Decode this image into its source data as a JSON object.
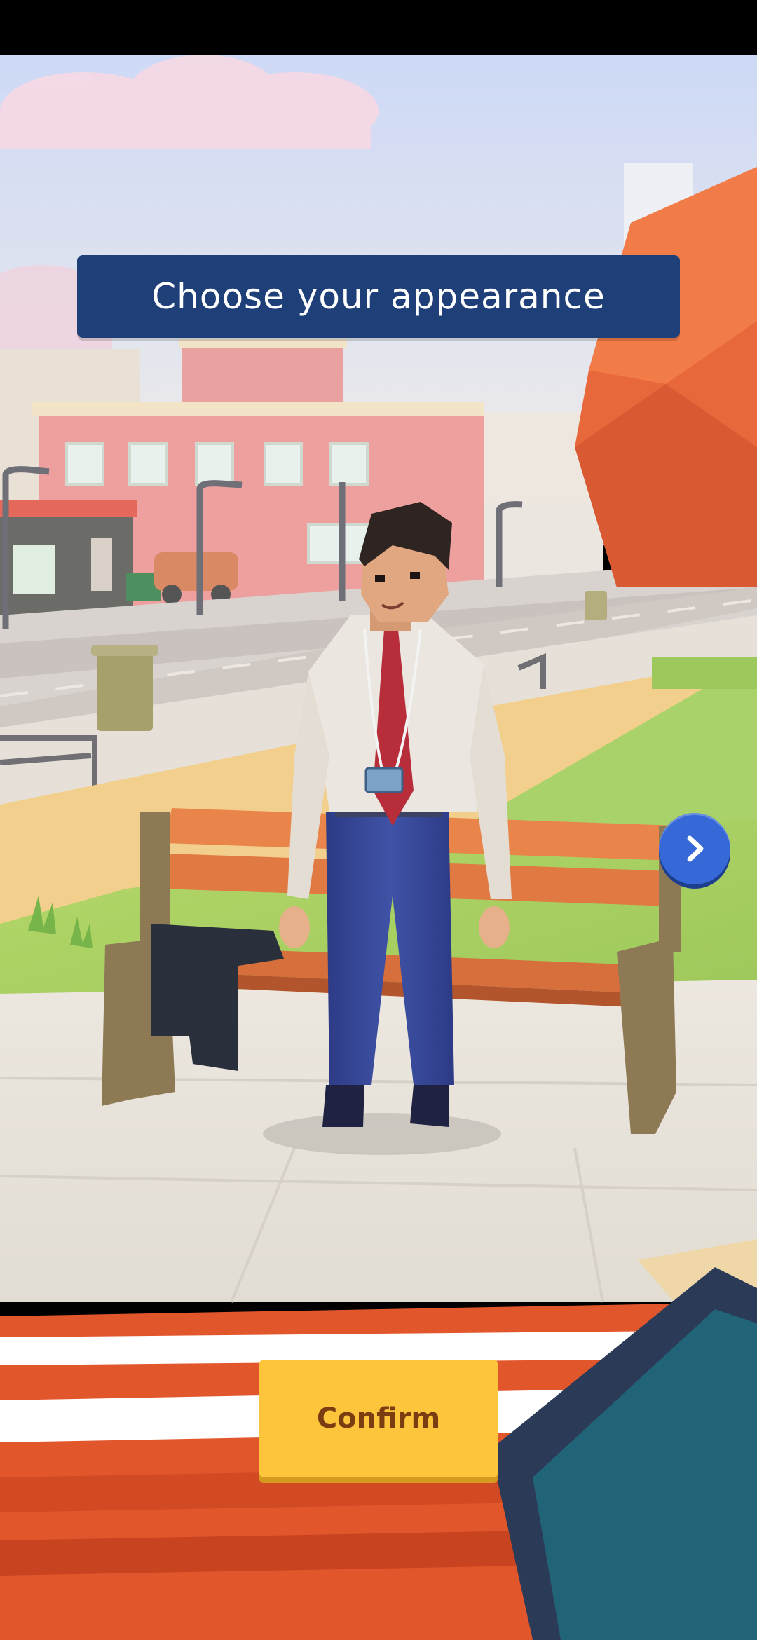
{
  "screen": {
    "title": "Choose your appearance",
    "next_icon": "chevron-right-icon",
    "confirm_label": "Confirm"
  },
  "colors": {
    "banner": "#1e3f78",
    "next_button": "#3768d8",
    "confirm_button": "#fdc53b",
    "confirm_text": "#7a3d12"
  }
}
